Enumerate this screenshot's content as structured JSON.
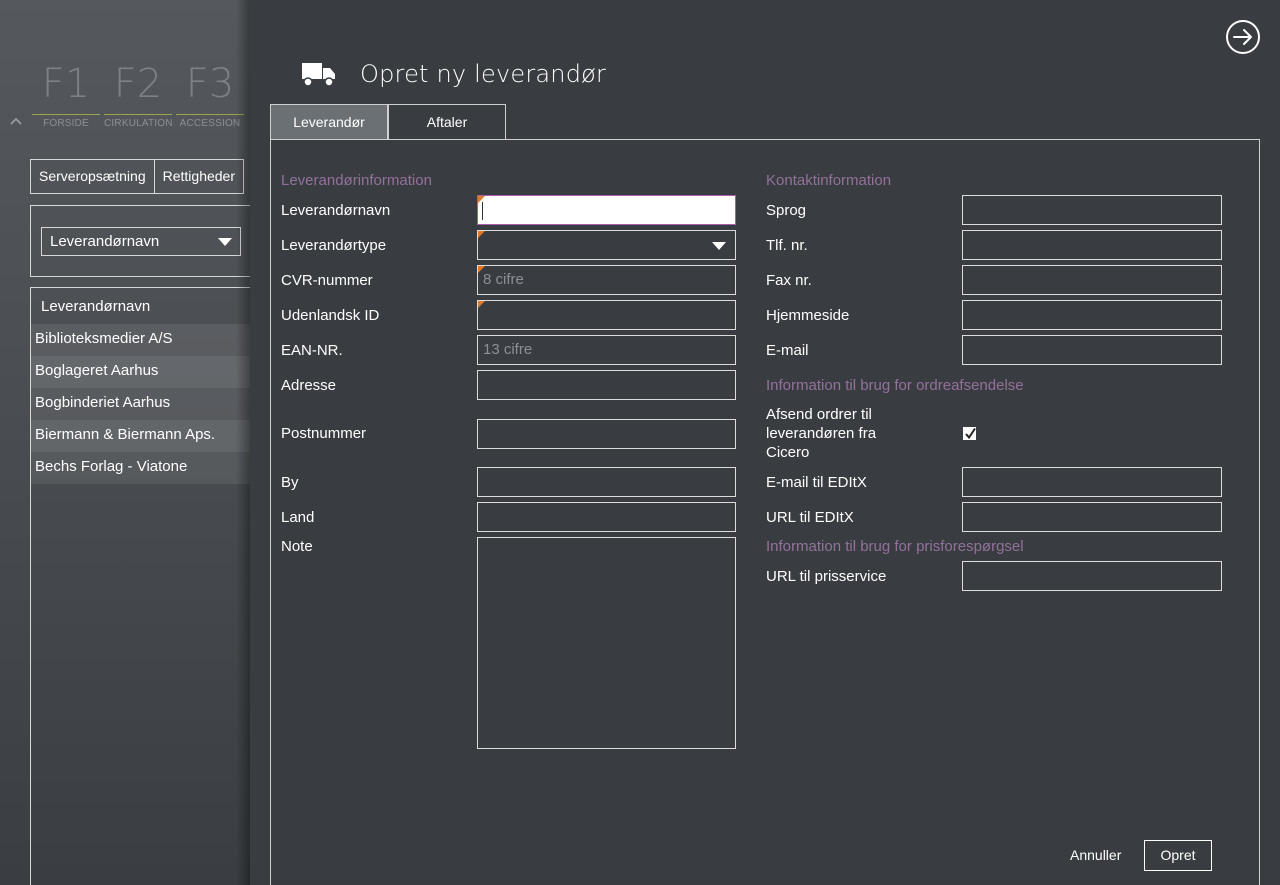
{
  "background_app": {
    "fkeys": [
      {
        "key": "F1",
        "label": "FORSIDE"
      },
      {
        "key": "F2",
        "label": "CIRKULATION"
      },
      {
        "key": "F3",
        "label": "ACCESSION"
      }
    ],
    "buttons": [
      "Serveropsætning",
      "Rettigheder"
    ],
    "filter_select": "Leverandørnavn",
    "list_header": "Leverandørnavn",
    "list_rows": [
      "Biblioteksmedier A/S",
      "Boglageret Aarhus",
      "Bogbinderiet Aarhus",
      "Biermann & Biermann Aps.",
      "Bechs Forlag - Viatone"
    ]
  },
  "dialog": {
    "title": "Opret ny leverandør",
    "icon": "truck-icon",
    "tabs": [
      "Leverandør",
      "Aftaler"
    ],
    "left": {
      "section": "Leverandørinformation",
      "fields": {
        "name": {
          "label": "Leverandørnavn",
          "value": ""
        },
        "type": {
          "label": "Leverandørtype",
          "value": ""
        },
        "cvr": {
          "label": "CVR-nummer",
          "placeholder": "8 cifre"
        },
        "foreign_id": {
          "label": "Udenlandsk ID",
          "value": ""
        },
        "ean": {
          "label": "EAN-NR.",
          "placeholder": "13 cifre"
        },
        "address": {
          "label": "Adresse",
          "value": ""
        },
        "postal": {
          "label": "Postnummer",
          "value": ""
        },
        "city": {
          "label": "By",
          "value": ""
        },
        "country": {
          "label": "Land",
          "value": ""
        },
        "note": {
          "label": "Note",
          "value": ""
        }
      }
    },
    "right": {
      "contact_section": "Kontaktinformation",
      "language": "Sprog",
      "phone": "Tlf. nr.",
      "fax": "Fax nr.",
      "website": "Hjemmeside",
      "email": "E-mail",
      "order_section": "Information til brug for ordreafsendelse",
      "send_orders": {
        "line1": "Afsend ordrer til",
        "line2": "leverandøren fra",
        "line3": "Cicero",
        "checked": true
      },
      "editx_email": "E-mail til EDItX",
      "editx_url": "URL til EDItX",
      "price_section": "Information til brug for prisforespørgsel",
      "price_url": "URL til prisservice"
    },
    "buttons": {
      "cancel": "Annuller",
      "create": "Opret"
    }
  },
  "colors": {
    "section_title": "#93719a",
    "required_marker": "#e07a2a",
    "dialog_bg": "#393d41"
  }
}
